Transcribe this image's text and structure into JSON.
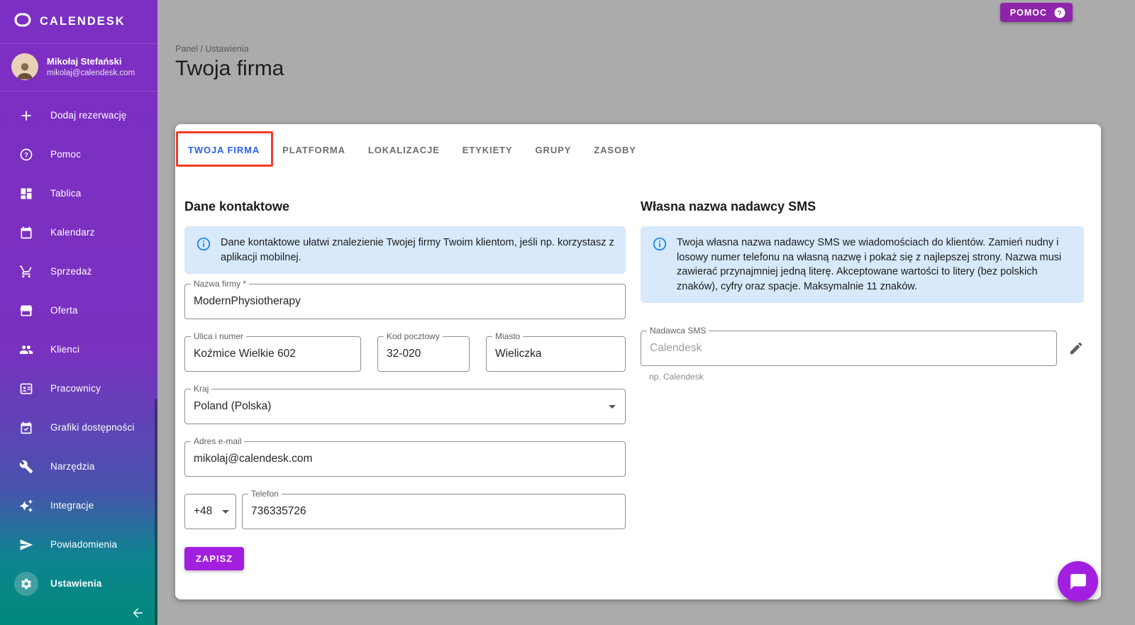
{
  "brand": {
    "name": "CALENDESK"
  },
  "user": {
    "name": "Mikołaj Stefański",
    "email": "mikolaj@calendesk.com"
  },
  "sidebar": {
    "items": [
      {
        "label": "Dodaj rezerwację",
        "icon": "plus-icon"
      },
      {
        "label": "Pomoc",
        "icon": "help-icon"
      },
      {
        "label": "Tablica",
        "icon": "dashboard-icon"
      },
      {
        "label": "Kalendarz",
        "icon": "calendar-icon"
      },
      {
        "label": "Sprzedaż",
        "icon": "cart-icon"
      },
      {
        "label": "Oferta",
        "icon": "storefront-icon"
      },
      {
        "label": "Klienci",
        "icon": "people-icon"
      },
      {
        "label": "Pracownicy",
        "icon": "employee-badge-icon"
      },
      {
        "label": "Grafiki dostępności",
        "icon": "availability-calendar-icon"
      },
      {
        "label": "Narzędzia",
        "icon": "tools-icon"
      },
      {
        "label": "Integracje",
        "icon": "integrations-icon"
      },
      {
        "label": "Powiadomienia",
        "icon": "send-icon"
      },
      {
        "label": "Ustawienia",
        "icon": "gear-icon",
        "active": true
      }
    ]
  },
  "topbar": {
    "help_button": "POMOC"
  },
  "page": {
    "breadcrumb": "Panel / Ustawienia",
    "title": "Twoja firma"
  },
  "tabs": [
    {
      "label": "TWOJA FIRMA",
      "active": true
    },
    {
      "label": "PLATFORMA"
    },
    {
      "label": "LOKALIZACJE"
    },
    {
      "label": "ETYKIETY"
    },
    {
      "label": "GRUPY"
    },
    {
      "label": "ZASOBY"
    }
  ],
  "contact": {
    "heading": "Dane kontaktowe",
    "info": "Dane kontaktowe ułatwi znalezienie Twojej firmy Twoim klientom, jeśli np. korzystasz z aplikacji mobilnej.",
    "fields": {
      "company": {
        "label": "Nazwa firmy *",
        "value": "ModernPhysiotherapy"
      },
      "street": {
        "label": "Ulica i numer",
        "value": "Koźmice Wielkie 602"
      },
      "postal": {
        "label": "Kod pocztowy",
        "value": "32-020"
      },
      "city": {
        "label": "Miasto",
        "value": "Wieliczka"
      },
      "country": {
        "label": "Kraj",
        "value": "Poland (Polska)"
      },
      "email": {
        "label": "Adres e-mail",
        "value": "mikolaj@calendesk.com"
      },
      "phone_prefix": {
        "value": "+48"
      },
      "phone": {
        "label": "Telefon",
        "value": "736335726"
      }
    },
    "save_button": "ZAPISZ"
  },
  "sms": {
    "heading": "Własna nazwa nadawcy SMS",
    "info": "Twoja własna nazwa nadawcy SMS we wiadomościach do klientów. Zamień nudny i losowy numer telefonu na własną nazwę i pokaż się z najlepszej strony. Nazwa musi zawierać przynajmniej jedną literę. Akceptowane wartości to litery (bez polskich znaków), cyfry oraz spacje. Maksymalnie 11 znaków.",
    "field": {
      "label": "Nadawca SMS",
      "placeholder": "Calendesk"
    },
    "helper": "np. Calendesk"
  },
  "colors": {
    "brand_purple": "#7c2fc3",
    "teal": "#00897b",
    "accent_blue": "#2760e8",
    "button_purple": "#a21fe0",
    "help_button_purple": "#8e24aa",
    "annotation_red": "#f23b2b",
    "info_box_bg": "#d7e9fb",
    "page_bg": "#ababab"
  }
}
